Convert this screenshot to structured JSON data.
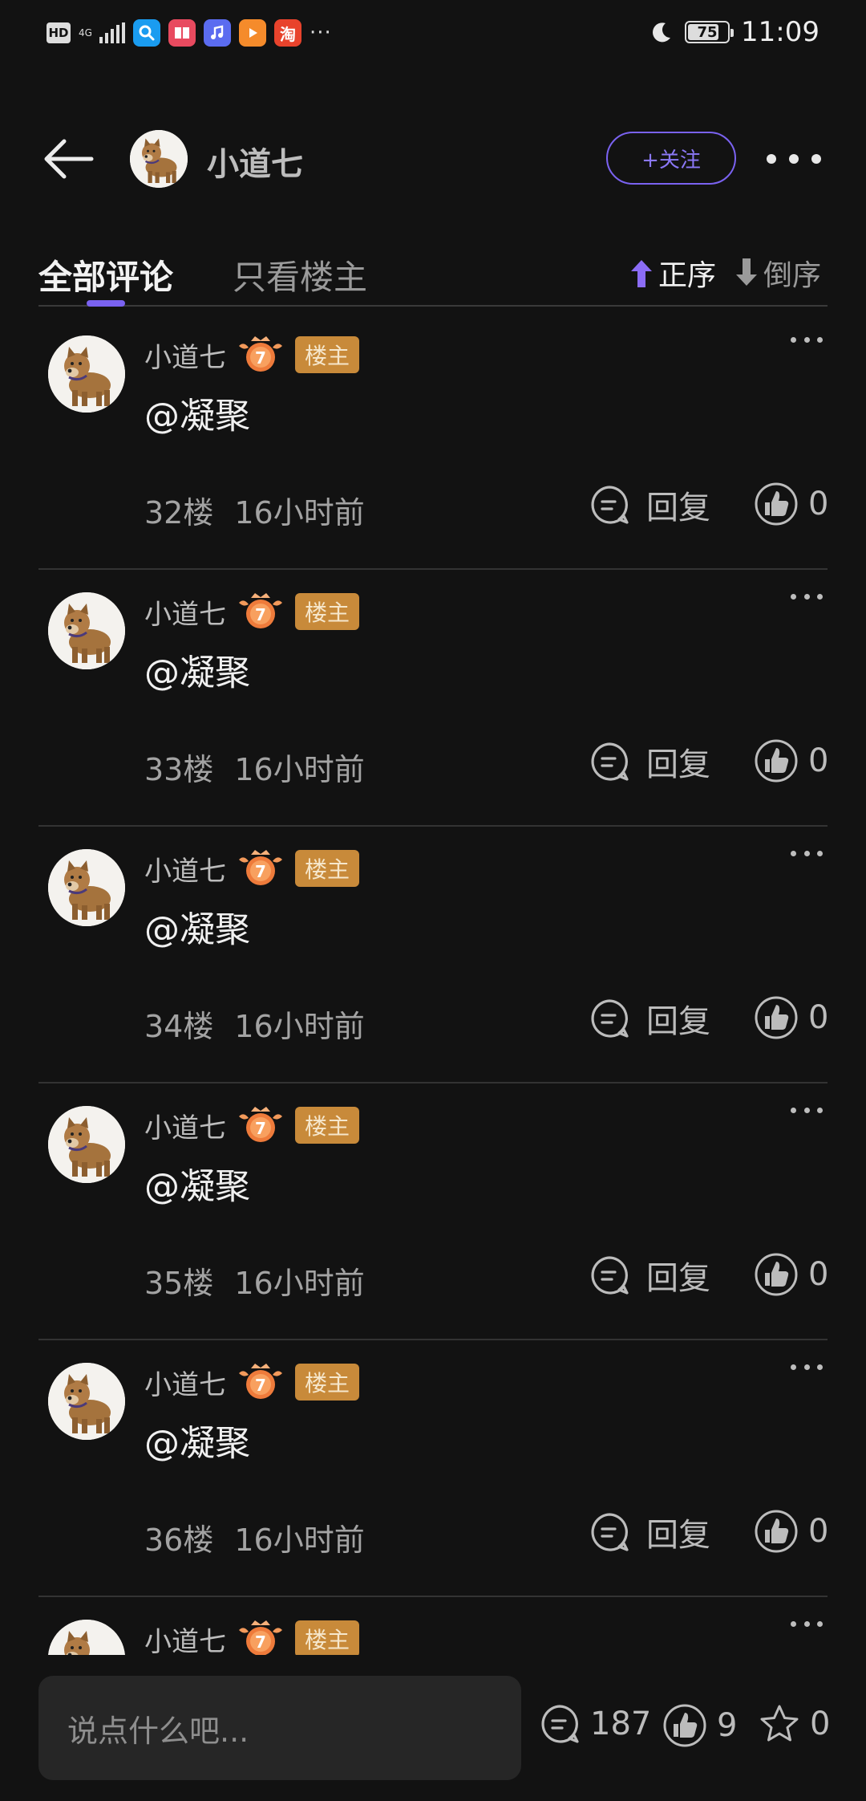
{
  "status_bar": {
    "hd": "HD",
    "network": "4G",
    "battery": "75",
    "time": "11:09",
    "more": "···"
  },
  "header": {
    "title": "小道七",
    "follow_label": "+关注"
  },
  "tabs": {
    "all": "全部评论",
    "owner_only": "只看楼主",
    "sort_asc": "正序",
    "sort_desc": "倒序"
  },
  "owner_tag": "楼主",
  "level": "7",
  "comments": [
    {
      "name": "小道七",
      "text": "@凝聚",
      "floor": "32楼",
      "time": "16小时前",
      "reply_label": "回复",
      "likes": "0"
    },
    {
      "name": "小道七",
      "text": "@凝聚",
      "floor": "33楼",
      "time": "16小时前",
      "reply_label": "回复",
      "likes": "0"
    },
    {
      "name": "小道七",
      "text": "@凝聚",
      "floor": "34楼",
      "time": "16小时前",
      "reply_label": "回复",
      "likes": "0"
    },
    {
      "name": "小道七",
      "text": "@凝聚",
      "floor": "35楼",
      "time": "16小时前",
      "reply_label": "回复",
      "likes": "0"
    },
    {
      "name": "小道七",
      "text": "@凝聚",
      "floor": "36楼",
      "time": "16小时前",
      "reply_label": "回复",
      "likes": "0"
    },
    {
      "name": "小道七"
    }
  ],
  "bottom_bar": {
    "input_placeholder": "说点什么吧...",
    "comment_count": "187",
    "like_count": "9",
    "favorite_count": "0"
  },
  "colors": {
    "accent": "#7a62f0",
    "owner_tag": "#c88a3a",
    "background": "#121212"
  }
}
